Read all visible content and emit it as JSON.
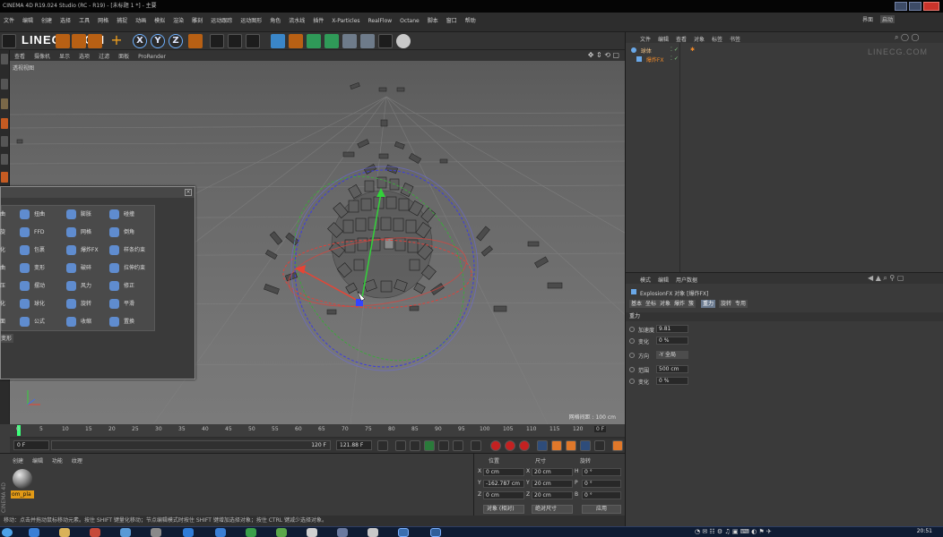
{
  "window": {
    "title": "CINEMA 4D R19.024 Studio (RC - R19) - [未标题 1 *] - 主要",
    "controls": [
      "minimize",
      "maximize",
      "close"
    ]
  },
  "menubar": {
    "items": [
      "文件",
      "编辑",
      "创建",
      "选择",
      "工具",
      "网格",
      "捕捉",
      "动画",
      "模拟",
      "渲染",
      "雕刻",
      "运动跟踪",
      "运动图形",
      "角色",
      "流水线",
      "插件",
      "X-Particles",
      "RealFlow",
      "Octane",
      "脚本",
      "窗口",
      "帮助"
    ],
    "right_items": [
      "界面",
      "启动"
    ]
  },
  "toolbar": {
    "logo": "LINECG.COM",
    "axis_buttons": [
      "X",
      "Y",
      "Z"
    ]
  },
  "viewport": {
    "menu": [
      "查看",
      "摄像机",
      "显示",
      "选项",
      "过滤",
      "面板",
      "ProRender"
    ],
    "title": "透视视图",
    "grid_scale": "网格间距 : 100 cm"
  },
  "object_window": {
    "items": [
      [
        "扭曲",
        "膨胀",
        "碰撞"
      ],
      [
        "FFD",
        "网格",
        "倒角"
      ],
      [
        "包裹",
        "爆炸FX",
        "样条约束"
      ],
      [
        "变形",
        "破碎",
        "拉伸约束"
      ],
      [
        "摆动",
        "风力",
        "修正"
      ],
      [
        "球化",
        "旋转",
        "平滑"
      ],
      [
        "公式",
        "收缩",
        "置换"
      ]
    ],
    "row_prefixes": [
      "扭曲",
      "螺旋",
      "锥化",
      "弯曲",
      "挤压",
      "融化",
      "表面",
      "变形"
    ]
  },
  "timeline": {
    "ticks": [
      "0",
      "5",
      "10",
      "15",
      "20",
      "25",
      "30",
      "35",
      "40",
      "45",
      "50",
      "55",
      "60",
      "65",
      "70",
      "75",
      "80",
      "85",
      "90",
      "95",
      "100",
      "105",
      "110",
      "115",
      "120"
    ],
    "current_frame": "0 F",
    "start_field": "0 F",
    "end_field": "120 F",
    "end_display": "121.88 F"
  },
  "material_manager": {
    "menu": [
      "创建",
      "编辑",
      "功能",
      "纹理"
    ],
    "material_label": "om_pla"
  },
  "coordinates": {
    "headers": [
      "位置",
      "尺寸",
      "旋转"
    ],
    "rows": [
      {
        "axis": "X",
        "pos": "0 cm",
        "size_axis": "X",
        "size": "20 cm",
        "rot_axis": "H",
        "rot": "0 °"
      },
      {
        "axis": "Y",
        "pos": "-162.787 cm",
        "size_axis": "Y",
        "size": "20 cm",
        "rot_axis": "P",
        "rot": "0 °"
      },
      {
        "axis": "Z",
        "pos": "0 cm",
        "size_axis": "Z",
        "size": "20 cm",
        "rot_axis": "B",
        "rot": "0 °"
      }
    ],
    "mode_select": "对象 (相对)",
    "size_select": "绝对尺寸",
    "apply_button": "应用"
  },
  "statusbar": {
    "text": "移动：点击并拖动鼠标移动元素。按住 SHIFT 键量化移动；节点编辑模式时按住 SHIFT 键增加选择对象；按住 CTRL 键减少选择对象。"
  },
  "object_manager": {
    "menu": [
      "文件",
      "编辑",
      "查看",
      "对象",
      "标签",
      "书签"
    ],
    "watermark": "LINECG.COM",
    "objects": [
      {
        "name": "球体",
        "color": "#f2c48a"
      },
      {
        "name": "爆炸FX",
        "color": "#f08a2a"
      }
    ]
  },
  "attributes": {
    "menu": [
      "模式",
      "编辑",
      "用户数据"
    ],
    "object_title": "ExplosionFX 对象 [爆炸FX]",
    "tabs": [
      "基本",
      "坐标",
      "对象",
      "爆炸",
      "簇",
      "重力",
      "旋转",
      "专用"
    ],
    "active_tab": "重力",
    "section": "重力",
    "params": [
      {
        "label": "加速度",
        "value": "9.81"
      },
      {
        "label": "变化",
        "value": "0 %"
      },
      {
        "label": "方向",
        "value": "-Y 全局"
      },
      {
        "label": "范围",
        "value": "500 cm"
      },
      {
        "label": "变化",
        "value": "0 %"
      }
    ]
  },
  "taskbar": {
    "clock": "20:51"
  },
  "colors": {
    "accent": "#6fb1ff",
    "playhead": "#3cff7a",
    "material_tag": "#e29a16",
    "record": "#c42121"
  }
}
